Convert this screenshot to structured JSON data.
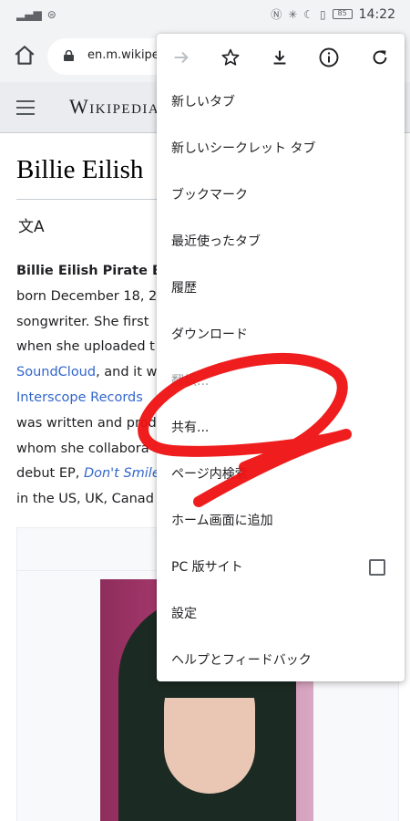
{
  "status_bar": {
    "time": "14:22",
    "battery_level": "85"
  },
  "browser": {
    "url": "en.m.wikipedia.org"
  },
  "wiki": {
    "logo": "Wikipedia",
    "title": "Billie Eilish",
    "language_icon": "文A",
    "paragraph": {
      "l1_bold": "Billie Eilish Pirate Ba",
      "l2": "born December 18, 2",
      "l3": "songwriter. She first",
      "l4": "when she uploaded t",
      "l5_link": "SoundCloud",
      "l5_rest": ", and it w",
      "l6_link": "Interscope Records",
      "l7": "was written and prod",
      "l8": "whom she collabora",
      "l9_pre": "debut EP, ",
      "l9_italic_link": "Don't Smile",
      "l10": "in the US, UK, Canad"
    }
  },
  "menu": {
    "icons": [
      "forward-icon",
      "star-icon",
      "download-icon",
      "info-icon",
      "refresh-icon"
    ],
    "items": [
      {
        "label": "新しいタブ"
      },
      {
        "label": "新しいシークレット タブ"
      },
      {
        "label": "ブックマーク"
      },
      {
        "label": "最近使ったタブ"
      },
      {
        "label": "履歴"
      },
      {
        "label": "ダウンロード"
      },
      {
        "label": "翻訳..."
      },
      {
        "label": "共有..."
      },
      {
        "label": "ページ内検索"
      },
      {
        "label": "ホーム画面に追加"
      },
      {
        "label": "PC 版サイト"
      },
      {
        "label": "設定"
      },
      {
        "label": "ヘルプとフィードバック"
      }
    ],
    "pc_site_checked": false
  },
  "colors": {
    "accent_link": "#3366cc",
    "annotation_red": "#ee1111"
  }
}
